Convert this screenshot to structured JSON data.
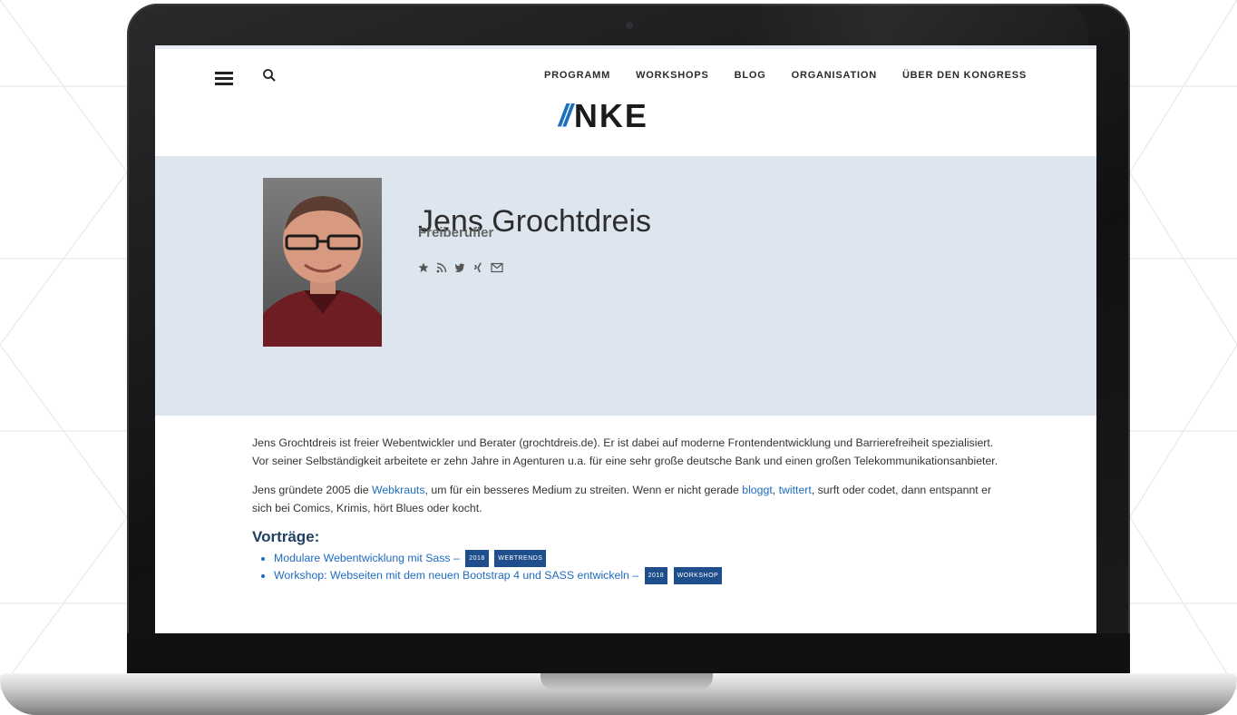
{
  "nav": {
    "menu_icon": "hamburger-menu-icon",
    "search_icon": "search-icon",
    "items": [
      {
        "label": "PROGRAMM"
      },
      {
        "label": "WORKSHOPS"
      },
      {
        "label": "BLOG"
      },
      {
        "label": "ORGANISATION"
      },
      {
        "label": "ÜBER DEN KONGRESS"
      }
    ]
  },
  "logo": {
    "slashes": "//",
    "word": "NKE",
    "accent_color": "#1a6fc0"
  },
  "speaker": {
    "name": "Jens Grochtdreis",
    "role": "Freiberufler",
    "social_icons": [
      "star-icon",
      "rss-icon",
      "twitter-icon",
      "xing-icon",
      "mail-icon"
    ]
  },
  "bio": {
    "p1": "Jens Grochtdreis ist freier Webentwickler und Berater (grochtdreis.de). Er ist dabei auf moderne Frontendentwicklung und Barrierefreiheit spezialisiert. Vor seiner Selbständigkeit arbeitete er zehn Jahre in Agenturen u.a. für eine sehr große deutsche Bank und einen großen Telekommunikationsanbieter.",
    "p2_a": "Jens gründete 2005 die ",
    "p2_link1": "Webkrauts",
    "p2_b": ", um für ein besseres Medium zu streiten. Wenn er nicht gerade ",
    "p2_link2": "bloggt",
    "p2_c": ", ",
    "p2_link3": "twittert",
    "p2_d": ", surft oder codet, dann entspannt er sich bei Comics, Krimis, hört Blues oder kocht."
  },
  "talks": {
    "heading": "Vorträge:",
    "items": [
      {
        "title": "Modulare Webentwicklung mit Sass –",
        "year": "2018",
        "track": "WEBTRENDS"
      },
      {
        "title": "Workshop: Webseiten mit dem neuen Bootstrap 4 und SASS entwickeln –",
        "year": "2018",
        "track": "WORKSHOP"
      }
    ]
  },
  "colors": {
    "hero_background": "#dde5ef",
    "link": "#1e6cc0",
    "tag_background": "#1e4f8c",
    "heading": "#1f3f63"
  }
}
